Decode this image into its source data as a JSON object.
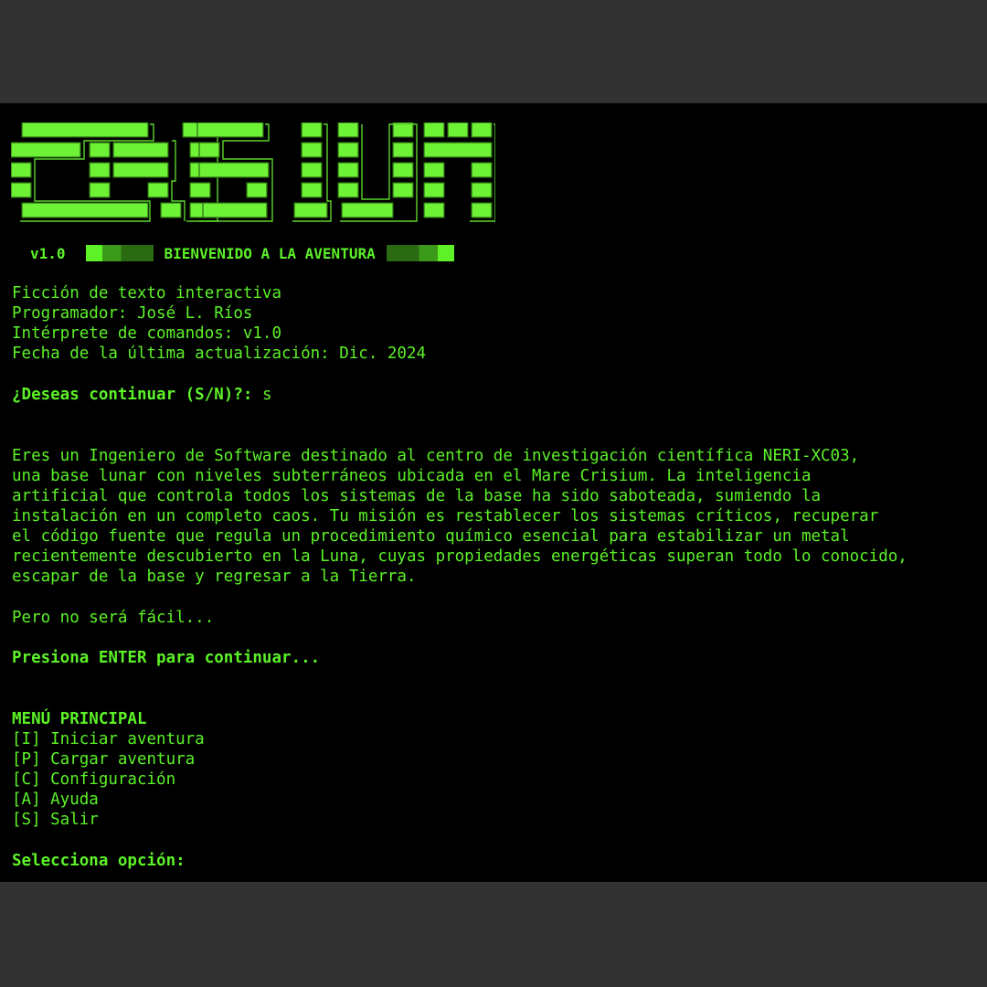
{
  "header": {
    "logo_text": "CRISIUM",
    "version": "v1.0",
    "welcome": "BIENVENIDO A LA AVENTURA"
  },
  "info": {
    "line1": "Ficción de texto interactiva",
    "line2": "Programador: José L. Ríos",
    "line3": "Intérprete de comandos: v1.0",
    "line4": "Fecha de la última actualización: Dic. 2024"
  },
  "prompt": {
    "question": "¿Deseas continuar (S/N)?: ",
    "answer": "s"
  },
  "story": {
    "lines": [
      "Eres un Ingeniero de Software destinado al centro de investigación científica NERI-XC03,",
      "una base lunar con niveles subterráneos ubicada en el Mare Crisium. La inteligencia",
      "artificial que controla todos los sistemas de la base ha sido saboteada, sumiendo la",
      "instalación en un completo caos. Tu misión es restablecer los sistemas críticos, recuperar",
      "el código fuente que regula un procedimiento químico esencial para estabilizar un metal",
      "recientemente descubierto en la Luna, cuyas propiedades energéticas superan todo lo conocido,",
      "escapar de la base y regresar a la Tierra."
    ],
    "teaser": "Pero no será fácil...",
    "continue_prompt": "Presiona ENTER para continuar..."
  },
  "menu": {
    "title": "MENÚ PRINCIPAL",
    "items": [
      {
        "label": "[I] Iniciar aventura"
      },
      {
        "label": "[P] Cargar aventura"
      },
      {
        "label": "[C] Configuración"
      },
      {
        "label": "[A] Ayuda"
      },
      {
        "label": "[S] Salir"
      }
    ],
    "select_prompt": "Selecciona opción:"
  },
  "colors": {
    "terminal_bg": "#000000",
    "text_green": "#5cf227",
    "window_bg": "#323232"
  }
}
